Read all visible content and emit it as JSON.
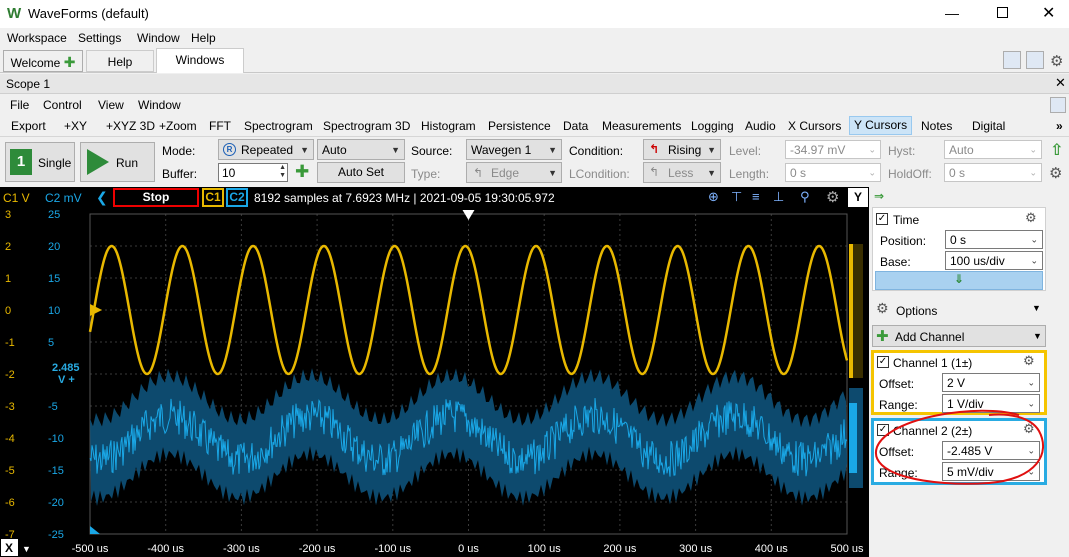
{
  "window": {
    "title": "WaveForms (default)"
  },
  "menubar": {
    "items": [
      "Workspace",
      "Settings",
      "Window",
      "Help"
    ]
  },
  "tabs": {
    "welcome": "Welcome",
    "help": "Help",
    "windows": "Windows"
  },
  "scope": {
    "title": "Scope 1"
  },
  "scope_menu": {
    "items": [
      "File",
      "Control",
      "View",
      "Window"
    ]
  },
  "toolbar": {
    "items": [
      "Export",
      "+XY",
      "+XYZ 3D",
      "+Zoom",
      "FFT",
      "Spectrogram",
      "Spectrogram 3D",
      "Histogram",
      "Persistence",
      "Data",
      "Measurements",
      "Logging",
      "Audio",
      "X Cursors",
      "Y Cursors",
      "Notes",
      "Digital"
    ]
  },
  "controls": {
    "single": "Single",
    "run": "Run",
    "mode_label": "Mode:",
    "mode_value": "Repeated",
    "auto_value": "Auto",
    "buffer_label": "Buffer:",
    "buffer_value": "10",
    "autoset": "Auto Set",
    "source_label": "Source:",
    "source_value": "Wavegen 1",
    "type_label": "Type:",
    "type_value": "Edge",
    "condition_label": "Condition:",
    "condition_value": "Rising",
    "lcondition_label": "LCondition:",
    "lcondition_value": "Less",
    "level_label": "Level:",
    "level_value": "-34.97 mV",
    "length_label": "Length:",
    "length_value": "0 s",
    "hyst_label": "Hyst:",
    "hyst_value": "Auto",
    "holdoff_label": "HoldOff:",
    "holdoff_value": "0 s"
  },
  "status": {
    "c1_unit": "C1 V",
    "c2_unit": "C2 mV",
    "state": "Stop",
    "c1_tag": "C1",
    "c2_tag": "C2",
    "info": "8192 samples at 7.6923 MHz | 2021-09-05 19:30:05.972",
    "y_button": "Y"
  },
  "plot": {
    "c1_ticks": [
      "3",
      "2",
      "1",
      "0",
      "-1",
      "-2",
      "-3",
      "-4",
      "-5",
      "-6",
      "-7"
    ],
    "c2_ticks": [
      "25",
      "20",
      "15",
      "10",
      "5",
      "",
      "-5",
      "-10",
      "-15",
      "-20",
      "-25"
    ],
    "offset_marker_value": "2.485",
    "offset_marker_unit": "V +",
    "x_ticks": [
      "-500 us",
      "-400 us",
      "-300 us",
      "-200 us",
      "-100 us",
      "0 us",
      "100 us",
      "200 us",
      "300 us",
      "400 us",
      "500 us"
    ],
    "x_button": "X",
    "c1_color": "#e8b800",
    "c2_color": "#1aa7e6"
  },
  "panel": {
    "time": {
      "title": "Time",
      "position_label": "Position:",
      "position_value": "0 s",
      "base_label": "Base:",
      "base_value": "100 us/div"
    },
    "options": "Options",
    "add_channel": "Add Channel",
    "ch1": {
      "title": "Channel 1 (1±)",
      "offset_label": "Offset:",
      "offset_value": "2 V",
      "range_label": "Range:",
      "range_value": "1 V/div",
      "color": "#f5c400"
    },
    "ch2": {
      "title": "Channel 2 (2±)",
      "offset_label": "Offset:",
      "offset_value": "-2.485 V",
      "range_label": "Range:",
      "range_value": "5 mV/div",
      "color": "#29abe2"
    }
  }
}
